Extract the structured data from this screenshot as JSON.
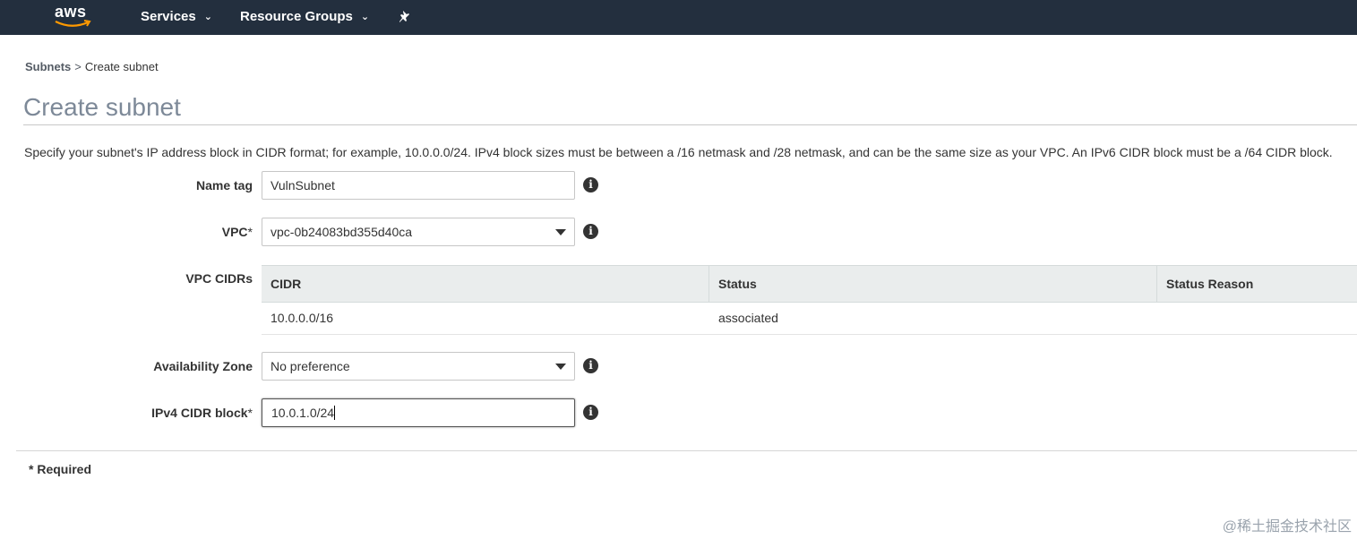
{
  "topbar": {
    "logo_text": "aws",
    "services_label": "Services",
    "resource_groups_label": "Resource Groups",
    "pin_icon": "pin-icon",
    "chevron_icon": "chevron-down-icon",
    "background_color": "#232f3e"
  },
  "breadcrumb": {
    "parent": "Subnets",
    "separator": ">",
    "current": "Create subnet"
  },
  "page": {
    "title": "Create subnet",
    "description": "Specify your subnet's IP address block in CIDR format; for example, 10.0.0.0/24. IPv4 block sizes must be between a /16 netmask and /28 netmask, and can be the same size as your VPC. An IPv6 CIDR block must be a /64 CIDR block."
  },
  "form": {
    "name_tag": {
      "label": "Name tag",
      "value": "VulnSubnet"
    },
    "vpc": {
      "label": "VPC",
      "required_mark": "*",
      "value": "vpc-0b24083bd355d40ca"
    },
    "vpc_cidrs": {
      "label": "VPC CIDRs",
      "columns": [
        "CIDR",
        "Status",
        "Status Reason"
      ],
      "rows": [
        {
          "cidr": "10.0.0.0/16",
          "status": "associated",
          "status_reason": ""
        }
      ]
    },
    "availability_zone": {
      "label": "Availability Zone",
      "value": "No preference"
    },
    "ipv4_cidr": {
      "label": "IPv4 CIDR block",
      "required_mark": "*",
      "value": "10.0.1.0/24"
    },
    "info_icon": "info-icon"
  },
  "footer": {
    "required_note": "* Required"
  },
  "watermark": "@稀土掘金技术社区"
}
